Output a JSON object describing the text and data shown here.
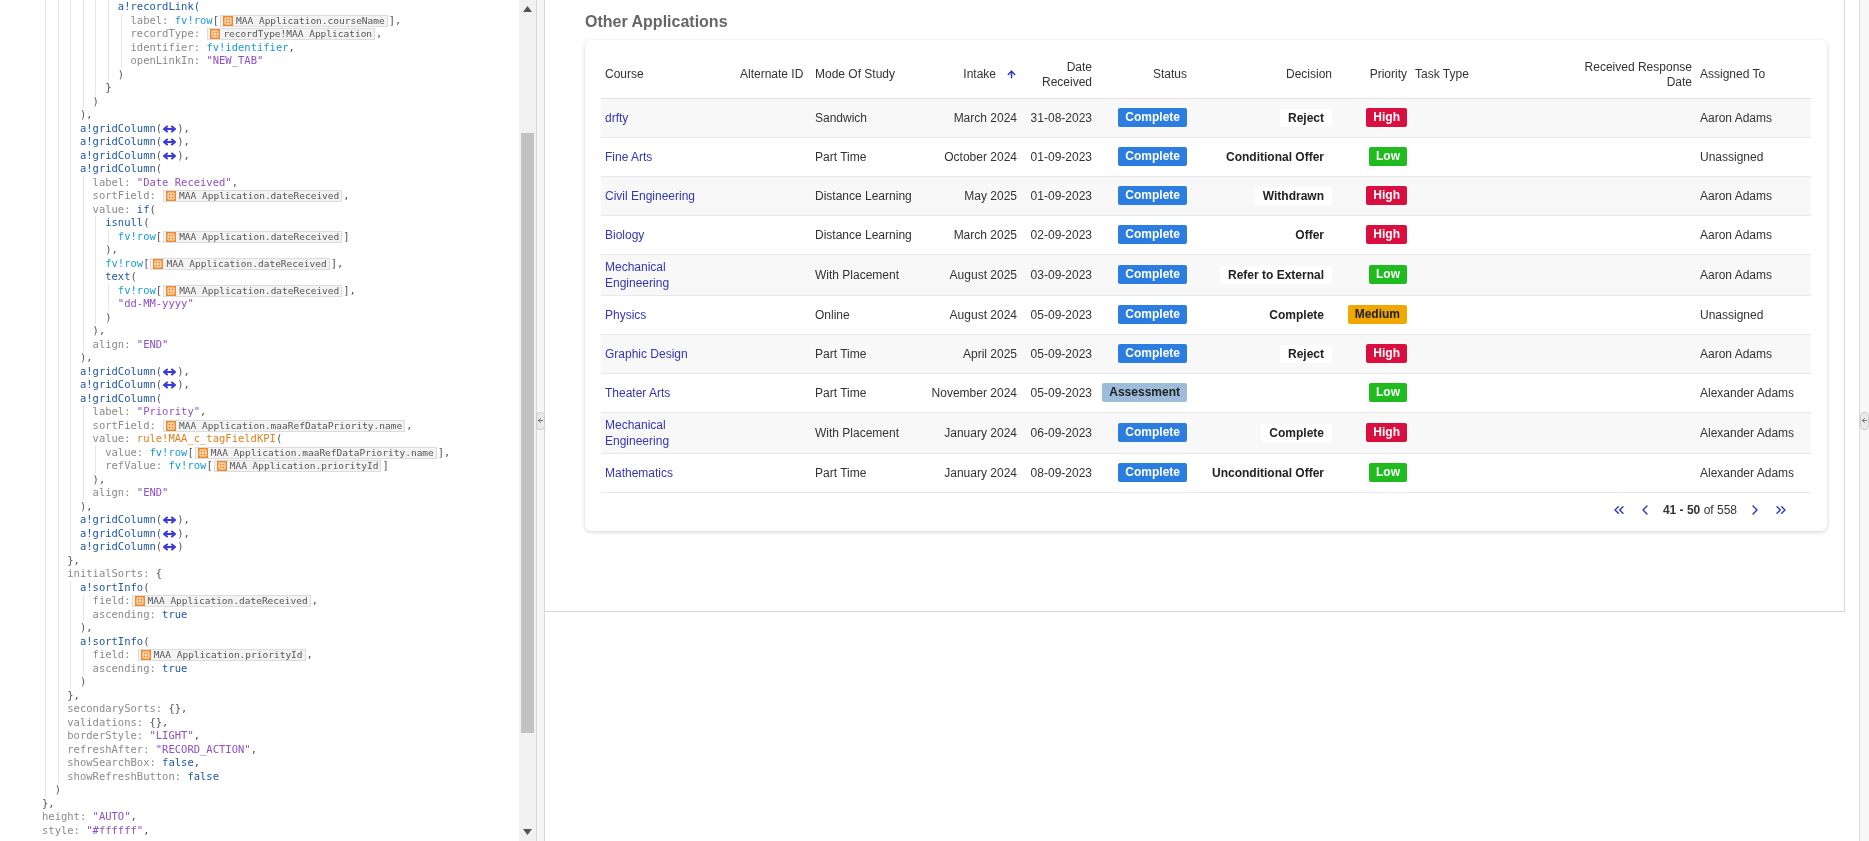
{
  "code_editor": {
    "lines": [
      {
        "segments": [
          {
            "kind": "func",
            "text": "            a!recordLink("
          }
        ]
      },
      {
        "segments": [
          {
            "kind": "key",
            "text": "              label: "
          },
          {
            "kind": "var",
            "text": "fv!row"
          },
          {
            "kind": "punct",
            "text": "["
          },
          {
            "kind": "field",
            "text": "MAA Application.courseName"
          },
          {
            "kind": "punct",
            "text": "],"
          }
        ]
      },
      {
        "segments": [
          {
            "kind": "key",
            "text": "              recordType: "
          },
          {
            "kind": "field",
            "text": "recordType!MAA Application"
          },
          {
            "kind": "punct",
            "text": ","
          }
        ]
      },
      {
        "segments": [
          {
            "kind": "key",
            "text": "              identifier: "
          },
          {
            "kind": "var",
            "text": "fv!identifier"
          },
          {
            "kind": "punct",
            "text": ","
          }
        ]
      },
      {
        "segments": [
          {
            "kind": "key",
            "text": "              openLinkIn: "
          },
          {
            "kind": "str",
            "text": "\"NEW_TAB\""
          }
        ]
      },
      {
        "segments": [
          {
            "kind": "punct",
            "text": "            )"
          }
        ]
      },
      {
        "segments": [
          {
            "kind": "punct",
            "text": "          }"
          }
        ]
      },
      {
        "segments": [
          {
            "kind": "punct",
            "text": "        )"
          }
        ]
      },
      {
        "segments": [
          {
            "kind": "punct",
            "text": "      ),"
          }
        ]
      },
      {
        "segments": [
          {
            "kind": "func",
            "text": "      a!gridColumn"
          },
          {
            "kind": "punct",
            "text": "("
          },
          {
            "kind": "fold"
          },
          {
            "kind": "punct",
            "text": "),"
          }
        ]
      },
      {
        "segments": [
          {
            "kind": "func",
            "text": "      a!gridColumn"
          },
          {
            "kind": "punct",
            "text": "("
          },
          {
            "kind": "fold"
          },
          {
            "kind": "punct",
            "text": "),"
          }
        ]
      },
      {
        "segments": [
          {
            "kind": "func",
            "text": "      a!gridColumn"
          },
          {
            "kind": "punct",
            "text": "("
          },
          {
            "kind": "fold"
          },
          {
            "kind": "punct",
            "text": "),"
          }
        ]
      },
      {
        "segments": [
          {
            "kind": "func",
            "text": "      a!gridColumn"
          },
          {
            "kind": "punct",
            "text": "("
          }
        ]
      },
      {
        "segments": [
          {
            "kind": "key",
            "text": "        label: "
          },
          {
            "kind": "str",
            "text": "\"Date Received\""
          },
          {
            "kind": "punct",
            "text": ","
          }
        ]
      },
      {
        "segments": [
          {
            "kind": "key",
            "text": "        sortField: "
          },
          {
            "kind": "field",
            "text": "MAA Application.dateReceived"
          },
          {
            "kind": "punct",
            "text": ","
          }
        ]
      },
      {
        "segments": [
          {
            "kind": "key",
            "text": "        value: "
          },
          {
            "kind": "func",
            "text": "if"
          },
          {
            "kind": "punct",
            "text": "("
          }
        ]
      },
      {
        "segments": [
          {
            "kind": "func",
            "text": "          isnull"
          },
          {
            "kind": "punct",
            "text": "("
          }
        ]
      },
      {
        "segments": [
          {
            "kind": "var",
            "text": "            fv!row"
          },
          {
            "kind": "punct",
            "text": "["
          },
          {
            "kind": "field",
            "text": "MAA Application.dateReceived"
          },
          {
            "kind": "punct",
            "text": "]"
          }
        ]
      },
      {
        "segments": [
          {
            "kind": "punct",
            "text": "          ),"
          }
        ]
      },
      {
        "segments": [
          {
            "kind": "var",
            "text": "          fv!row"
          },
          {
            "kind": "punct",
            "text": "["
          },
          {
            "kind": "field",
            "text": "MAA Application.dateReceived"
          },
          {
            "kind": "punct",
            "text": "],"
          }
        ]
      },
      {
        "segments": [
          {
            "kind": "func",
            "text": "          text"
          },
          {
            "kind": "punct",
            "text": "("
          }
        ]
      },
      {
        "segments": [
          {
            "kind": "var",
            "text": "            fv!row"
          },
          {
            "kind": "punct",
            "text": "["
          },
          {
            "kind": "field",
            "text": "MAA Application.dateReceived"
          },
          {
            "kind": "punct",
            "text": "],"
          }
        ]
      },
      {
        "segments": [
          {
            "kind": "str",
            "text": "            \"dd-MM-yyyy\""
          }
        ]
      },
      {
        "segments": [
          {
            "kind": "punct",
            "text": "          )"
          }
        ]
      },
      {
        "segments": [
          {
            "kind": "punct",
            "text": "        ),"
          }
        ]
      },
      {
        "segments": [
          {
            "kind": "key",
            "text": "        align: "
          },
          {
            "kind": "str",
            "text": "\"END\""
          }
        ]
      },
      {
        "segments": [
          {
            "kind": "punct",
            "text": "      ),"
          }
        ]
      },
      {
        "segments": [
          {
            "kind": "func",
            "text": "      a!gridColumn"
          },
          {
            "kind": "punct",
            "text": "("
          },
          {
            "kind": "fold"
          },
          {
            "kind": "punct",
            "text": "),"
          }
        ]
      },
      {
        "segments": [
          {
            "kind": "func",
            "text": "      a!gridColumn"
          },
          {
            "kind": "punct",
            "text": "("
          },
          {
            "kind": "fold"
          },
          {
            "kind": "punct",
            "text": "),"
          }
        ]
      },
      {
        "segments": [
          {
            "kind": "func",
            "text": "      a!gridColumn"
          },
          {
            "kind": "punct",
            "text": "("
          }
        ]
      },
      {
        "segments": [
          {
            "kind": "key",
            "text": "        label: "
          },
          {
            "kind": "str",
            "text": "\"Priority\""
          },
          {
            "kind": "punct",
            "text": ","
          }
        ]
      },
      {
        "segments": [
          {
            "kind": "key",
            "text": "        sortField: "
          },
          {
            "kind": "field",
            "text": "MAA Application.maaRefDataPriority.name"
          },
          {
            "kind": "punct",
            "text": ","
          }
        ]
      },
      {
        "segments": [
          {
            "kind": "key",
            "text": "        value: "
          },
          {
            "kind": "rule",
            "text": "rule!MAA_c_tagFieldKPI"
          },
          {
            "kind": "punct",
            "text": "("
          }
        ]
      },
      {
        "segments": [
          {
            "kind": "key",
            "text": "          value: "
          },
          {
            "kind": "var",
            "text": "fv!row"
          },
          {
            "kind": "punct",
            "text": "["
          },
          {
            "kind": "field",
            "text": "MAA Application.maaRefDataPriority.name"
          },
          {
            "kind": "punct",
            "text": "],"
          }
        ]
      },
      {
        "segments": [
          {
            "kind": "key",
            "text": "          refValue: "
          },
          {
            "kind": "var",
            "text": "fv!row"
          },
          {
            "kind": "punct",
            "text": "["
          },
          {
            "kind": "field",
            "text": "MAA Application.priorityId"
          },
          {
            "kind": "punct",
            "text": "]"
          }
        ]
      },
      {
        "segments": [
          {
            "kind": "punct",
            "text": "        ),"
          }
        ]
      },
      {
        "segments": [
          {
            "kind": "key",
            "text": "        align: "
          },
          {
            "kind": "str",
            "text": "\"END\""
          }
        ]
      },
      {
        "segments": [
          {
            "kind": "punct",
            "text": "      ),"
          }
        ]
      },
      {
        "segments": [
          {
            "kind": "func",
            "text": "      a!gridColumn"
          },
          {
            "kind": "punct",
            "text": "("
          },
          {
            "kind": "fold"
          },
          {
            "kind": "punct",
            "text": "),"
          }
        ]
      },
      {
        "segments": [
          {
            "kind": "func",
            "text": "      a!gridColumn"
          },
          {
            "kind": "punct",
            "text": "("
          },
          {
            "kind": "fold"
          },
          {
            "kind": "punct",
            "text": "),"
          }
        ]
      },
      {
        "segments": [
          {
            "kind": "func",
            "text": "      a!gridColumn"
          },
          {
            "kind": "punct",
            "text": "("
          },
          {
            "kind": "fold"
          },
          {
            "kind": "punct",
            "text": ")"
          }
        ]
      },
      {
        "segments": [
          {
            "kind": "punct",
            "text": "    },"
          }
        ]
      },
      {
        "segments": [
          {
            "kind": "key",
            "text": "    initialSorts: "
          },
          {
            "kind": "punct",
            "text": "{"
          }
        ]
      },
      {
        "segments": [
          {
            "kind": "func",
            "text": "      a!sortInfo"
          },
          {
            "kind": "punct",
            "text": "("
          }
        ]
      },
      {
        "segments": [
          {
            "kind": "key",
            "text": "        field:"
          },
          {
            "kind": "field",
            "text": "MAA Application.dateReceived"
          },
          {
            "kind": "punct",
            "text": ","
          }
        ]
      },
      {
        "segments": [
          {
            "kind": "key",
            "text": "        ascending: "
          },
          {
            "kind": "bool",
            "text": "true"
          }
        ]
      },
      {
        "segments": [
          {
            "kind": "punct",
            "text": "      ),"
          }
        ]
      },
      {
        "segments": [
          {
            "kind": "func",
            "text": "      a!sortInfo"
          },
          {
            "kind": "punct",
            "text": "("
          }
        ]
      },
      {
        "segments": [
          {
            "kind": "key",
            "text": "        field: "
          },
          {
            "kind": "field",
            "text": "MAA Application.priorityId"
          },
          {
            "kind": "punct",
            "text": ","
          }
        ]
      },
      {
        "segments": [
          {
            "kind": "key",
            "text": "        ascending: "
          },
          {
            "kind": "bool",
            "text": "true"
          }
        ]
      },
      {
        "segments": [
          {
            "kind": "punct",
            "text": "      )"
          }
        ]
      },
      {
        "segments": [
          {
            "kind": "punct",
            "text": "    },"
          }
        ]
      },
      {
        "segments": [
          {
            "kind": "key",
            "text": "    secondarySorts: "
          },
          {
            "kind": "punct",
            "text": "{},"
          }
        ]
      },
      {
        "segments": [
          {
            "kind": "key",
            "text": "    validations: "
          },
          {
            "kind": "punct",
            "text": "{},"
          }
        ]
      },
      {
        "segments": [
          {
            "kind": "key",
            "text": "    borderStyle: "
          },
          {
            "kind": "str",
            "text": "\"LIGHT\""
          },
          {
            "kind": "punct",
            "text": ","
          }
        ]
      },
      {
        "segments": [
          {
            "kind": "key",
            "text": "    refreshAfter: "
          },
          {
            "kind": "str",
            "text": "\"RECORD_ACTION\""
          },
          {
            "kind": "punct",
            "text": ","
          }
        ]
      },
      {
        "segments": [
          {
            "kind": "key",
            "text": "    showSearchBox: "
          },
          {
            "kind": "bool",
            "text": "false"
          },
          {
            "kind": "punct",
            "text": ","
          }
        ]
      },
      {
        "segments": [
          {
            "kind": "key",
            "text": "    showRefreshButton: "
          },
          {
            "kind": "bool",
            "text": "false"
          }
        ]
      },
      {
        "segments": [
          {
            "kind": "punct",
            "text": "  )"
          }
        ]
      },
      {
        "segments": [
          {
            "kind": "punct",
            "text": "},"
          }
        ]
      },
      {
        "segments": [
          {
            "kind": "key",
            "text": "height: "
          },
          {
            "kind": "str",
            "text": "\"AUTO\""
          },
          {
            "kind": "punct",
            "text": ","
          }
        ]
      },
      {
        "segments": [
          {
            "kind": "key",
            "text": "style: "
          },
          {
            "kind": "str",
            "text": "\"#ffffff\""
          },
          {
            "kind": "punct",
            "text": ","
          }
        ]
      }
    ]
  },
  "section": {
    "title": "Other Applications",
    "table": {
      "columns": [
        {
          "label": "Course",
          "sorted": false
        },
        {
          "label": "Alternate ID",
          "sorted": false
        },
        {
          "label": "Mode Of Study",
          "sorted": false
        },
        {
          "label": "Intake",
          "sorted": true
        },
        {
          "label": "Date Received",
          "sorted": false
        },
        {
          "label": "Status",
          "sorted": false
        },
        {
          "label": "Decision",
          "sorted": false
        },
        {
          "label": "Priority",
          "sorted": false
        },
        {
          "label": "Task Type",
          "sorted": false
        },
        {
          "label": "Received Response Date",
          "sorted": false
        },
        {
          "label": "Assigned To",
          "sorted": false
        }
      ],
      "rows": [
        {
          "course": "drfty",
          "mode": "Sandwich",
          "intake": "March 2024",
          "date_received": "31-08-2023",
          "status": {
            "text": "Complete",
            "color": "#2b7de0"
          },
          "decision": "Reject",
          "priority": {
            "text": "High",
            "color": "#d9103f"
          },
          "assigned_to": "Aaron Adams"
        },
        {
          "course": "Fine Arts",
          "mode": "Part Time",
          "intake": "October 2024",
          "date_received": "01-09-2023",
          "status": {
            "text": "Complete",
            "color": "#2b7de0"
          },
          "decision": "Conditional Offer",
          "priority": {
            "text": "Low",
            "color": "#1fbb1f"
          },
          "assigned_to": "Unassigned"
        },
        {
          "course": "Civil Engineering",
          "mode": "Distance Learning",
          "intake": "May 2025",
          "date_received": "01-09-2023",
          "status": {
            "text": "Complete",
            "color": "#2b7de0"
          },
          "decision": "Withdrawn",
          "priority": {
            "text": "High",
            "color": "#d9103f"
          },
          "assigned_to": "Aaron Adams"
        },
        {
          "course": "Biology",
          "mode": "Distance Learning",
          "intake": "March 2025",
          "date_received": "02-09-2023",
          "status": {
            "text": "Complete",
            "color": "#2b7de0"
          },
          "decision": "Offer",
          "priority": {
            "text": "High",
            "color": "#d9103f"
          },
          "assigned_to": "Aaron Adams"
        },
        {
          "course": "Mechanical Engineering",
          "mode": "With Placement",
          "intake": "August 2025",
          "date_received": "03-09-2023",
          "status": {
            "text": "Complete",
            "color": "#2b7de0"
          },
          "decision": "Refer to External",
          "priority": {
            "text": "Low",
            "color": "#1fbb1f"
          },
          "assigned_to": "Aaron Adams"
        },
        {
          "course": "Physics",
          "mode": "Online",
          "intake": "August 2024",
          "date_received": "05-09-2023",
          "status": {
            "text": "Complete",
            "color": "#2b7de0"
          },
          "decision": "Complete",
          "priority": {
            "text": "Medium",
            "color": "#f0a800"
          },
          "assigned_to": "Unassigned"
        },
        {
          "course": "Graphic Design",
          "mode": "Part Time",
          "intake": "April 2025",
          "date_received": "05-09-2023",
          "status": {
            "text": "Complete",
            "color": "#2b7de0"
          },
          "decision": "Reject",
          "priority": {
            "text": "High",
            "color": "#d9103f"
          },
          "assigned_to": "Aaron Adams"
        },
        {
          "course": "Theater Arts",
          "mode": "Part Time",
          "intake": "November 2024",
          "date_received": "05-09-2023",
          "status": {
            "text": "Assessment",
            "color": "#9dbcda"
          },
          "priority": {
            "text": "Low",
            "color": "#1fbb1f"
          },
          "assigned_to": "Alexander Adams"
        },
        {
          "course": "Mechanical Engineering",
          "mode": "With Placement",
          "intake": "January 2024",
          "date_received": "06-09-2023",
          "status": {
            "text": "Complete",
            "color": "#2b7de0"
          },
          "decision": "Complete",
          "priority": {
            "text": "High",
            "color": "#d9103f"
          },
          "assigned_to": "Alexander Adams"
        },
        {
          "course": "Mathematics",
          "mode": "Part Time",
          "intake": "January 2024",
          "date_received": "08-09-2023",
          "status": {
            "text": "Complete",
            "color": "#2b7de0"
          },
          "decision": "Unconditional Offer",
          "priority": {
            "text": "Low",
            "color": "#1fbb1f"
          },
          "assigned_to": "Alexander Adams"
        }
      ],
      "pagination": {
        "range": "**41 - 50** of 558"
      }
    }
  }
}
